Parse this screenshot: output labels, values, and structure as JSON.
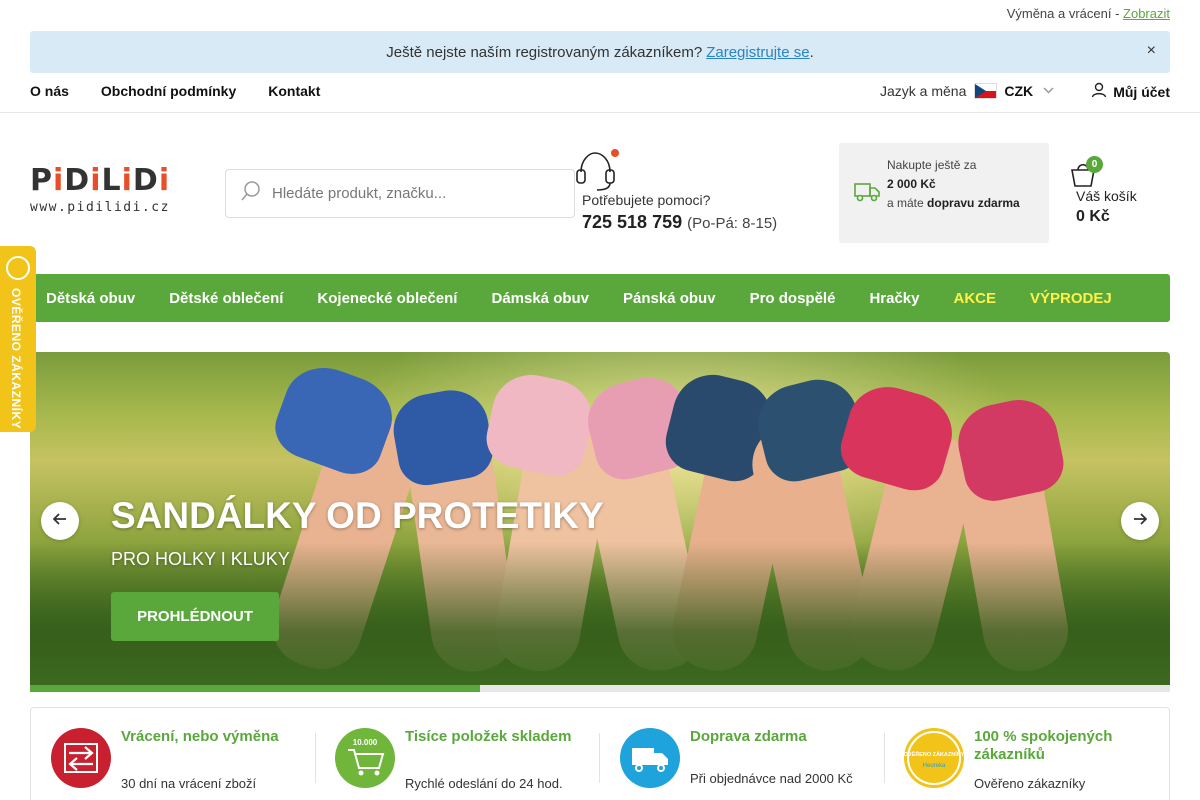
{
  "topline": {
    "text": "Výměna a vrácení -",
    "link": "Zobrazit"
  },
  "notice": {
    "text": "Ještě nejste naším registrovaným zákazníkem?",
    "link": "Zaregistrujte se",
    "period": ".",
    "close": "×"
  },
  "utilnav": {
    "items": [
      "O nás",
      "Obchodní podmínky",
      "Kontakt"
    ]
  },
  "lang": {
    "label": "Jazyk a měna",
    "currency": "CZK"
  },
  "account": {
    "label": "Můj účet"
  },
  "logo": {
    "text_parts": [
      "P",
      "i",
      "D",
      "i",
      "L",
      "i",
      "D",
      "i"
    ],
    "url": "www.pidilidi.cz"
  },
  "search": {
    "placeholder": "Hledáte produkt, značku..."
  },
  "help": {
    "question": "Potřebujete pomoci?",
    "phone": "725 518 759",
    "hours": "(Po-Pá: 8-15)"
  },
  "shipping": {
    "line1": "Nakupte ještě za",
    "amount": "2 000 Kč",
    "line2": "a máte",
    "free": "dopravu zdarma"
  },
  "cart": {
    "count": "0",
    "label": "Váš košík",
    "price": "0 Kč"
  },
  "mainnav": {
    "items": [
      "Dětská obuv",
      "Dětské oblečení",
      "Kojenecké oblečení",
      "Dámská obuv",
      "Pánská obuv",
      "Pro dospělé",
      "Hračky",
      "AKCE",
      "VÝPRODEJ"
    ]
  },
  "hero": {
    "title": "SANDÁLKY OD PROTETIKY",
    "subtitle": "PRO HOLKY I KLUKY",
    "button": "PROHLÉDNOUT",
    "progress": 0.395
  },
  "side_badge": {
    "text": "OVĚŘENO ZÁKAZNÍKY"
  },
  "usp": [
    {
      "title": "Vrácení, nebo výměna",
      "desc": "30 dní na vrácení zboží",
      "icon": "return-arrows-icon",
      "color": "#c8202f"
    },
    {
      "title": "Tisíce položek skladem",
      "desc": "Rychlé odeslání do 24 hod.",
      "icon": "cart-10000-icon",
      "color": "#6fb63a",
      "badge": "10.000"
    },
    {
      "title": "Doprava zdarma",
      "desc": "Při objednávce nad 2000 Kč",
      "icon": "truck-icon",
      "color": "#1ea3dc"
    },
    {
      "title": "100 % spokojených zákazníků",
      "desc": "Ověřeno zákazníky",
      "icon": "heureka-seal-icon",
      "color": "#f2c318",
      "badge": "OVĚŘENO ZÁKAZNÍKY",
      "brand": "Heureka"
    }
  ],
  "colors": {
    "brand_green": "#5aa83c",
    "accent_yellow": "#fff04a",
    "notice_bg": "#d7eaf5",
    "link_blue": "#2a83c5"
  }
}
